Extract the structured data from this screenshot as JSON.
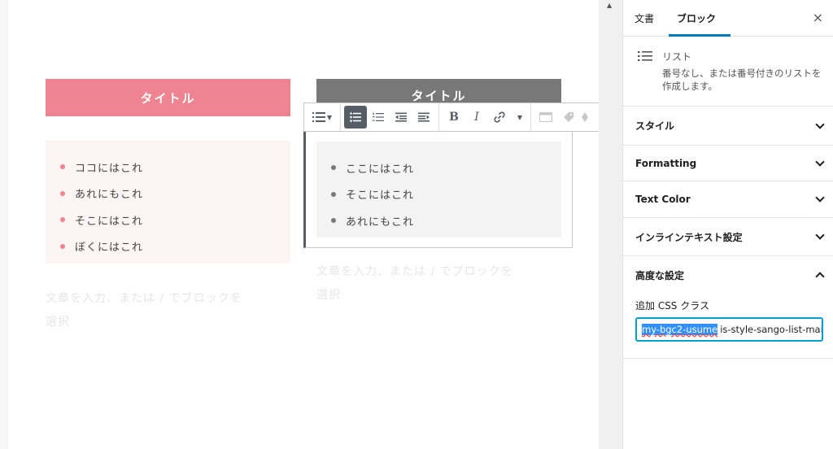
{
  "editor": {
    "left_block": {
      "title": "タイトル",
      "items": [
        "ココにはこれ",
        "あれにもこれ",
        "そこにはこれ",
        "ぼくにはこれ"
      ]
    },
    "right_block": {
      "title": "タイトル",
      "items": [
        "ここにはこれ",
        "そこにはこれ",
        "あれにもこれ"
      ]
    },
    "placeholder_line1": "文章を入力、または / でブロックを",
    "placeholder_line2": "選択"
  },
  "toolbar": {
    "list_icon": "list-icon",
    "bullet_icon": "unordered-list-icon",
    "numbered_icon": "ordered-list-icon",
    "outdent_icon": "outdent-icon",
    "indent_icon": "indent-icon",
    "bold": "B",
    "italic": "I",
    "link_icon": "link-icon"
  },
  "sidebar": {
    "tab_document": "文書",
    "tab_block": "ブロック",
    "close": "×",
    "block_name": "リスト",
    "block_desc": "番号なし、または番号付きのリストを作成します。",
    "panels": {
      "style": "スタイル",
      "formatting": "Formatting",
      "text_color": "Text Color",
      "inline": "インラインテキスト設定",
      "advanced": "高度な設定"
    },
    "css_label": "追加 CSS クラス",
    "css_selected": "my-bgc2-usume",
    "css_rest": "is-style-sango-list-main"
  },
  "colors": {
    "accent_pink": "#ee8490",
    "gray_title": "#787878",
    "focus_blue": "#007cba"
  }
}
